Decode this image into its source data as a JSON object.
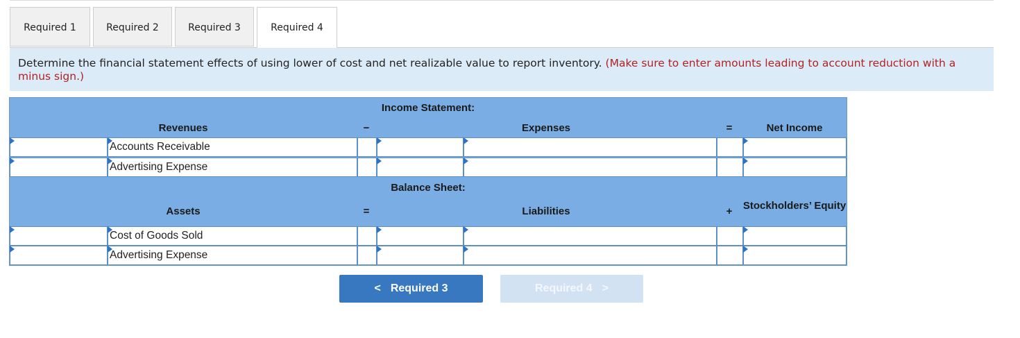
{
  "tabs": [
    {
      "label": "Required 1"
    },
    {
      "label": "Required 2"
    },
    {
      "label": "Required 3"
    },
    {
      "label": "Required 4"
    }
  ],
  "instruction": {
    "text": "Determine the financial statement effects of using lower of cost and net realizable value to report inventory.",
    "note": "(Make sure to enter amounts leading to account reduction with a minus sign.)"
  },
  "income_statement": {
    "title": "Income Statement:",
    "col_revenues": "Revenues",
    "op1": "−",
    "col_expenses": "Expenses",
    "op2": "=",
    "col_net_income": "Net Income",
    "rows": [
      {
        "revenue_account": "Accounts Receivable",
        "revenue_value": "",
        "expense_value": "",
        "expense_account": "",
        "net_income": ""
      },
      {
        "revenue_account": "Advertising Expense",
        "revenue_value": "",
        "expense_value": "",
        "expense_account": "",
        "net_income": ""
      }
    ]
  },
  "balance_sheet": {
    "title": "Balance Sheet:",
    "col_assets": "Assets",
    "op1": "=",
    "col_liabilities": "Liabilities",
    "op2": "+",
    "col_equity": "Stockholders’ Equity",
    "rows": [
      {
        "asset_account": "Cost of Goods Sold",
        "asset_value": "",
        "liability_value": "",
        "liability_account": "",
        "equity": ""
      },
      {
        "asset_account": "Advertising Expense",
        "asset_value": "",
        "liability_value": "",
        "liability_account": "",
        "equity": ""
      }
    ]
  },
  "nav": {
    "prev_label": "Required 3",
    "next_label": "Required 4",
    "prev_chevron": "<",
    "next_chevron": ">"
  },
  "colors": {
    "grid_header": "#7aade3",
    "instruction_bg": "#dcebf8",
    "note_red": "#b22222",
    "button_active": "#3878c0",
    "button_disabled": "#d3e2f3"
  }
}
